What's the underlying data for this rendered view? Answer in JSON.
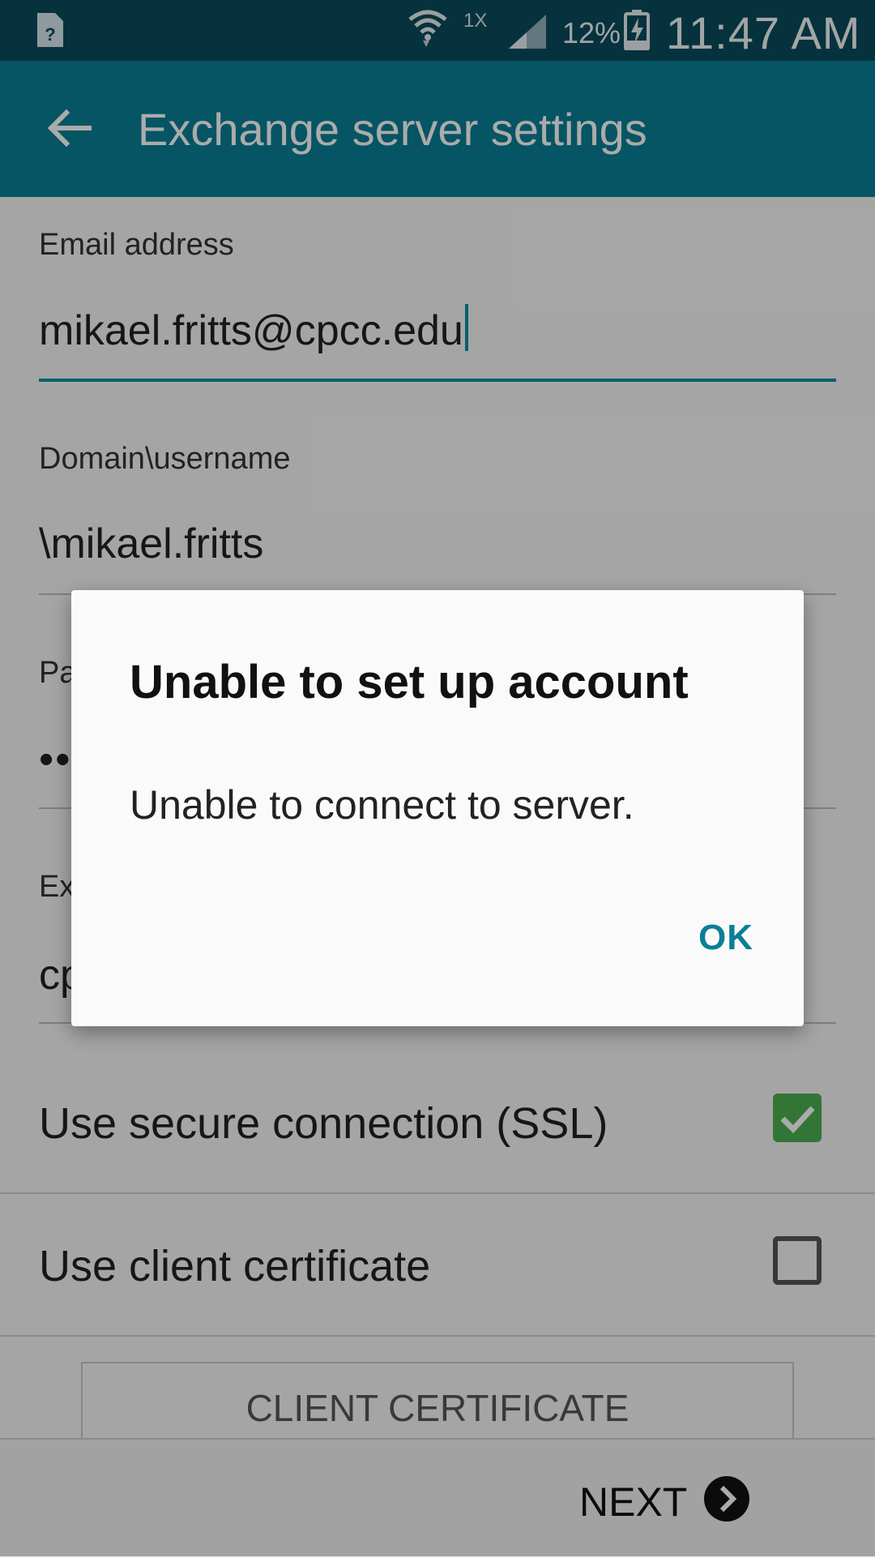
{
  "status_bar": {
    "sim_icon": "unknown-sim-icon",
    "network_type": "1X",
    "battery_percent": "12%",
    "time": "11:47 AM"
  },
  "app_bar": {
    "title": "Exchange server settings",
    "back_icon": "arrow-back-icon"
  },
  "form": {
    "email": {
      "label": "Email address",
      "value": "mikael.fritts@cpcc.edu"
    },
    "domain_username": {
      "label": "Domain\\username",
      "value": "\\mikael.fritts"
    },
    "password": {
      "label_partial": "Pa",
      "value_partial": "•••"
    },
    "exchange_server": {
      "label_partial": "Ex",
      "value_partial": "cp"
    }
  },
  "options": {
    "ssl": {
      "label": "Use secure connection (SSL)",
      "checked": true
    },
    "client_cert": {
      "label": "Use client certificate",
      "checked": false
    }
  },
  "client_certificate_button": "CLIENT CERTIFICATE",
  "bottom": {
    "next_label": "NEXT"
  },
  "dialog": {
    "title": "Unable to set up account",
    "message": "Unable to connect to server.",
    "ok_label": "OK"
  },
  "colors": {
    "status_bar": "#0a4b5b",
    "app_bar": "#0a7f96",
    "accent": "#0a90a8",
    "checkbox_checked": "#4caf50"
  }
}
